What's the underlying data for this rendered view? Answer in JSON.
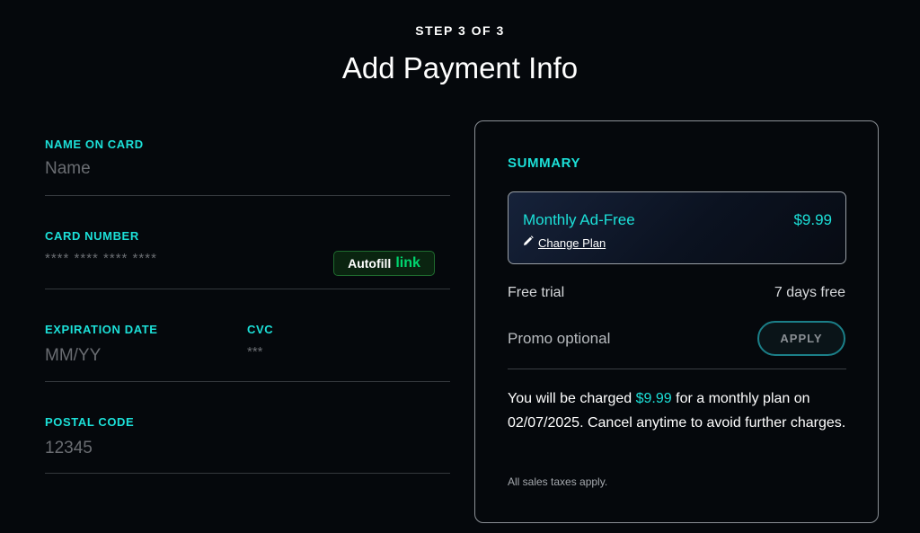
{
  "header": {
    "step": "STEP 3 OF 3",
    "title": "Add Payment Info"
  },
  "form": {
    "name_on_card": {
      "label": "NAME ON CARD",
      "placeholder": "Name",
      "value": ""
    },
    "card_number": {
      "label": "CARD NUMBER",
      "placeholder": "**** **** **** ****",
      "value": ""
    },
    "autofill": {
      "text": "Autofill",
      "link": "link"
    },
    "expiration": {
      "label": "EXPIRATION DATE",
      "placeholder": "MM/YY",
      "value": ""
    },
    "cvc": {
      "label": "CVC",
      "placeholder": "***",
      "value": ""
    },
    "postal": {
      "label": "POSTAL CODE",
      "placeholder": "12345",
      "value": ""
    }
  },
  "summary": {
    "title": "SUMMARY",
    "plan_name": "Monthly Ad-Free",
    "plan_price": "$9.99",
    "change_plan": "Change Plan",
    "trial_label": "Free trial",
    "trial_value": "7 days free",
    "promo_placeholder": "Promo optional",
    "apply_label": "APPLY",
    "charge_prefix": "You will be charged ",
    "charge_price": "$9.99",
    "charge_suffix": " for a monthly plan on 02/07/2025. Cancel anytime to avoid further charges.",
    "taxes": "All sales taxes apply."
  },
  "colors": {
    "accent": "#1ce0d8",
    "background": "#05080c",
    "link_green": "#00d66f"
  },
  "icons": {
    "change_plan": "pencil-icon"
  }
}
